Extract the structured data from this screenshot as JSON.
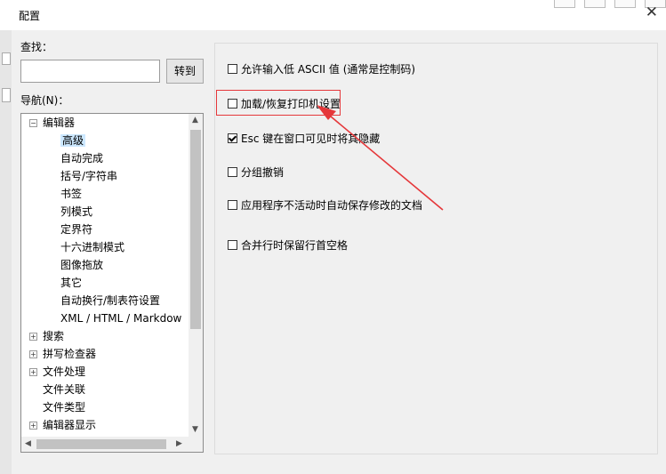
{
  "window": {
    "title": "配置",
    "close_glyph": "✕"
  },
  "search": {
    "label": "查找：",
    "value": "",
    "goto_button": "转到"
  },
  "nav": {
    "label": "导航(N)：",
    "tree": [
      {
        "label": "编辑器",
        "expander": "−"
      },
      {
        "label": "高级",
        "selected": true
      },
      {
        "label": "自动完成"
      },
      {
        "label": "括号/字符串"
      },
      {
        "label": "书签"
      },
      {
        "label": "列模式"
      },
      {
        "label": "定界符"
      },
      {
        "label": "十六进制模式"
      },
      {
        "label": "图像拖放"
      },
      {
        "label": "其它"
      },
      {
        "label": "自动换行/制表符设置"
      },
      {
        "label": "XML / HTML / Markdow"
      },
      {
        "label": "搜索",
        "expander": "+"
      },
      {
        "label": "拼写检查器",
        "expander": "+"
      },
      {
        "label": "文件处理",
        "expander": "+"
      },
      {
        "label": "文件关联"
      },
      {
        "label": "文件类型"
      },
      {
        "label": "编辑器显示",
        "expander": "+"
      }
    ]
  },
  "options": [
    {
      "label": "允许输入低 ASCII 值 (通常是控制码)",
      "checked": false
    },
    {
      "label": "加载/恢复打印机设置",
      "checked": false,
      "highlighted": true
    },
    {
      "label": "Esc 键在窗口可见时将其隐藏",
      "checked": true
    },
    {
      "label": "分组撤销",
      "checked": false
    },
    {
      "label": "应用程序不活动时自动保存修改的文档",
      "checked": false
    },
    {
      "label": "合并行时保留行首空格",
      "checked": false
    }
  ],
  "colors": {
    "highlight": "#e5373a",
    "selected_bg": "#cce8ff"
  }
}
